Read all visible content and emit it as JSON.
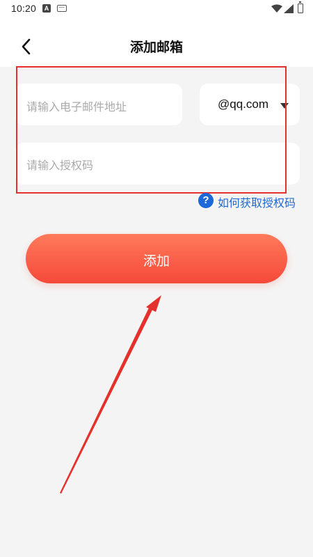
{
  "status_bar": {
    "time": "10:20",
    "icons": [
      "notification-a-icon",
      "keyboard-icon",
      "wifi-icon",
      "signal-icon",
      "battery-icon"
    ]
  },
  "header": {
    "title": "添加邮箱",
    "back_icon": "chevron-left-icon"
  },
  "form": {
    "email_placeholder": "请输入电子邮件地址",
    "email_value": "",
    "domain_selected": "@qq.com",
    "auth_placeholder": "请输入授权码",
    "auth_value": ""
  },
  "help_link": {
    "icon": "question-icon",
    "icon_glyph": "?",
    "text": "如何获取授权码"
  },
  "add_button": {
    "label": "添加"
  },
  "colors": {
    "accent_red": "#f5493a",
    "link_blue": "#1d68d8",
    "annotation_red": "#e5312b",
    "background": "#f4f4f4"
  }
}
